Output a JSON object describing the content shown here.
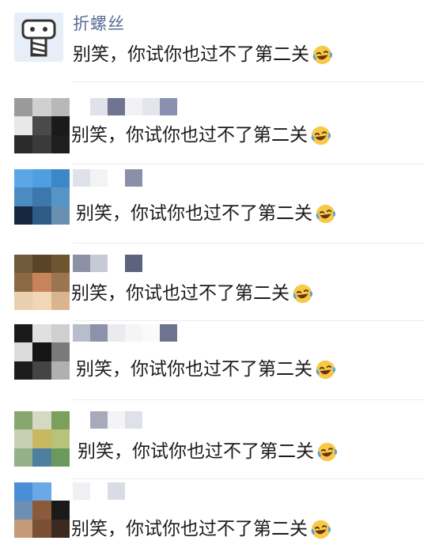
{
  "first": {
    "author": "折螺丝",
    "message": "别笑，你试你也过不了第二关"
  },
  "replies": [
    {
      "message": "别笑，你试你也过不了第二关"
    },
    {
      "message": "别笑，你试你也过不了第二关"
    },
    {
      "message": "别笑，你试也过不了第二关"
    },
    {
      "message": "别笑，你试你也过不了第二关"
    },
    {
      "message": "别笑，你试你也过不了第二关"
    },
    {
      "message": "别笑，你试你也过不了第二关"
    }
  ],
  "icons": {
    "first_avatar": "screw-robot-icon",
    "emoji": "rolling-on-floor-laughing-icon"
  },
  "colors": {
    "author_name": "#5a6d97",
    "message_text": "#1b1b1b",
    "separator": "#ececec"
  }
}
